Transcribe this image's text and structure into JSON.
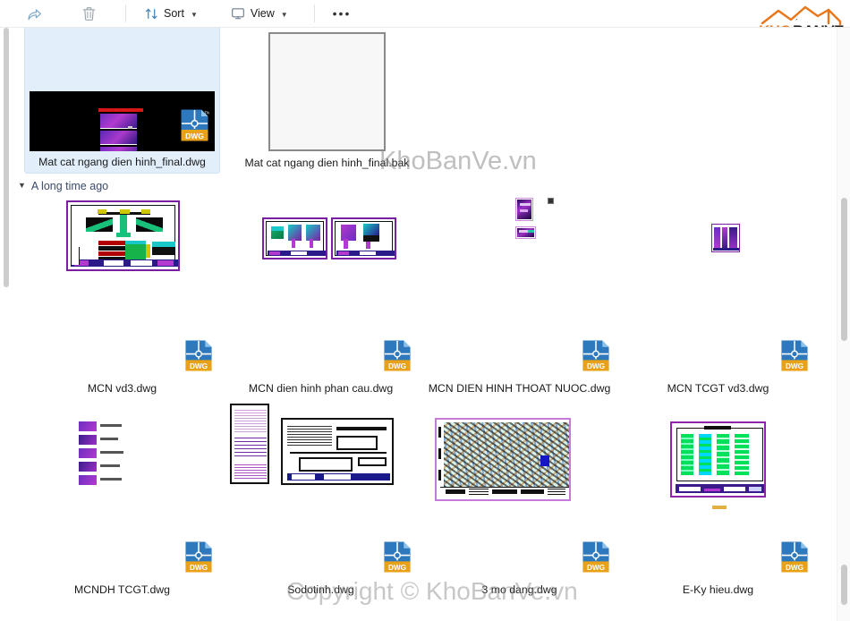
{
  "toolbar": {
    "buttons": [
      {
        "name": "share-button",
        "icon": "share-icon",
        "label": ""
      },
      {
        "name": "delete-button",
        "icon": "trash-icon",
        "label": ""
      },
      {
        "name": "sort-button",
        "icon": "sort-icon",
        "label": "Sort"
      },
      {
        "name": "view-button",
        "icon": "view-icon",
        "label": "View"
      },
      {
        "name": "more-button",
        "icon": "ellipsis-icon",
        "label": ""
      }
    ],
    "sort_label": "Sort",
    "view_label": "View",
    "more_label": "•••"
  },
  "logo": {
    "text_kho": "KHO",
    "text_banve": "BANVE",
    "color_orange": "#E8761B",
    "color_dark": "#1A1A1A"
  },
  "watermarks": {
    "top": "KhoBanVe.vn",
    "bottom": "Copyright © KhoBanVe.vn"
  },
  "groups": [
    {
      "name": "a-long-time-ago",
      "label": "A long time ago",
      "expanded": true,
      "caret": "⌄"
    }
  ],
  "files": [
    {
      "id": "f1",
      "label": "Mat cat ngang dien hinh_final.dwg",
      "type": "dwg",
      "selected": true,
      "preview": "black-cad",
      "has_dwg_badge": true
    },
    {
      "id": "f2",
      "label": "Mat cat ngang dien hinh_final.bak",
      "type": "bak",
      "selected": false,
      "preview": "blank-page",
      "has_dwg_badge": false
    },
    {
      "id": "f3",
      "label": "MCN vd3.dwg",
      "type": "dwg",
      "selected": false,
      "preview": "cad-section",
      "has_dwg_badge": true
    },
    {
      "id": "f4",
      "label": "MCN dien hinh phan cau.dwg",
      "type": "dwg",
      "selected": false,
      "preview": "cad-two-sheets",
      "has_dwg_badge": true
    },
    {
      "id": "f5",
      "label": "MCN DIEN HINH THOAT NUOC.dwg",
      "type": "dwg",
      "selected": false,
      "preview": "cad-small-pair",
      "has_dwg_badge": true
    },
    {
      "id": "f6",
      "label": "MCN TCGT vd3.dwg",
      "type": "dwg",
      "selected": false,
      "preview": "cad-small-single",
      "has_dwg_badge": true
    },
    {
      "id": "f7",
      "label": "MCNDH TCGT.dwg",
      "type": "dwg",
      "selected": false,
      "preview": "cad-list",
      "has_dwg_badge": true
    },
    {
      "id": "f8",
      "label": "Sodotinh.dwg",
      "type": "dwg",
      "selected": false,
      "preview": "cad-plan-pair",
      "has_dwg_badge": true
    },
    {
      "id": "f9",
      "label": "3 mo dang.dwg",
      "type": "dwg",
      "selected": false,
      "preview": "cad-dense-map",
      "has_dwg_badge": true
    },
    {
      "id": "f10",
      "label": "E-Ky hieu.dwg",
      "type": "dwg",
      "selected": false,
      "preview": "cad-green-file",
      "has_dwg_badge": true
    }
  ],
  "colors": {
    "selection_bg": "#E2EFFB",
    "group_header_text": "#3A4A6B",
    "dwg_blue": "#2E78BE",
    "dwg_gold": "#E9A117",
    "text": "#1A1A1A"
  }
}
